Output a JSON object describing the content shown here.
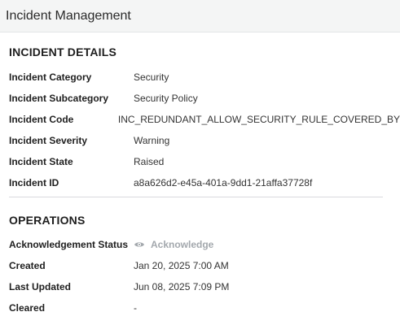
{
  "header": {
    "title": "Incident Management"
  },
  "details": {
    "title": "INCIDENT DETAILS",
    "rows": [
      {
        "label": "Incident Category",
        "value": "Security"
      },
      {
        "label": "Incident Subcategory",
        "value": "Security Policy"
      },
      {
        "label": "Incident Code",
        "value": "INC_REDUNDANT_ALLOW_SECURITY_RULE_COVERED_BY"
      },
      {
        "label": "Incident Severity",
        "value": "Warning"
      },
      {
        "label": "Incident State",
        "value": "Raised"
      },
      {
        "label": "Incident ID",
        "value": "a8a626d2-e45a-401a-9dd1-21affa37728f"
      }
    ]
  },
  "operations": {
    "title": "OPERATIONS",
    "acknowledgement": {
      "label": "Acknowledgement Status",
      "action_label": "Acknowledge",
      "icon": "eye-icon",
      "color": "#a3a8ad"
    },
    "created": {
      "label": "Created",
      "value": "Jan 20, 2025 7:00 AM"
    },
    "last_updated": {
      "label": "Last Updated",
      "value": "Jun 08, 2025 7:09 PM"
    },
    "cleared": {
      "label": "Cleared",
      "value": "-"
    }
  }
}
